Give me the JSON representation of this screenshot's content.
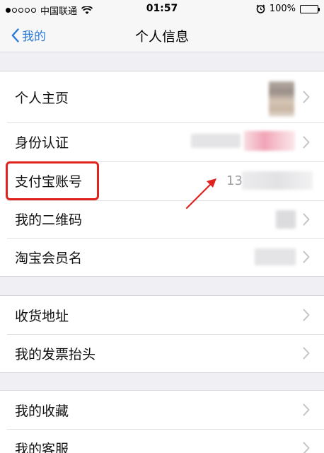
{
  "status_bar": {
    "carrier": "中国联通",
    "time": "01:57",
    "battery": "100%"
  },
  "nav": {
    "back_label": "我的",
    "title": "个人信息"
  },
  "groups": [
    {
      "items": [
        {
          "label": "个人主页"
        },
        {
          "label": "身份认证"
        },
        {
          "label": "支付宝账号",
          "value": "13"
        },
        {
          "label": "我的二维码"
        },
        {
          "label": "淘宝会员名"
        }
      ]
    },
    {
      "items": [
        {
          "label": "收货地址"
        },
        {
          "label": "我的发票抬头"
        }
      ]
    },
    {
      "items": [
        {
          "label": "我的收藏"
        },
        {
          "label": "我的客服"
        }
      ]
    }
  ],
  "colors": {
    "accent": "#2a7ad8",
    "annotation_red": "#e0231f"
  }
}
